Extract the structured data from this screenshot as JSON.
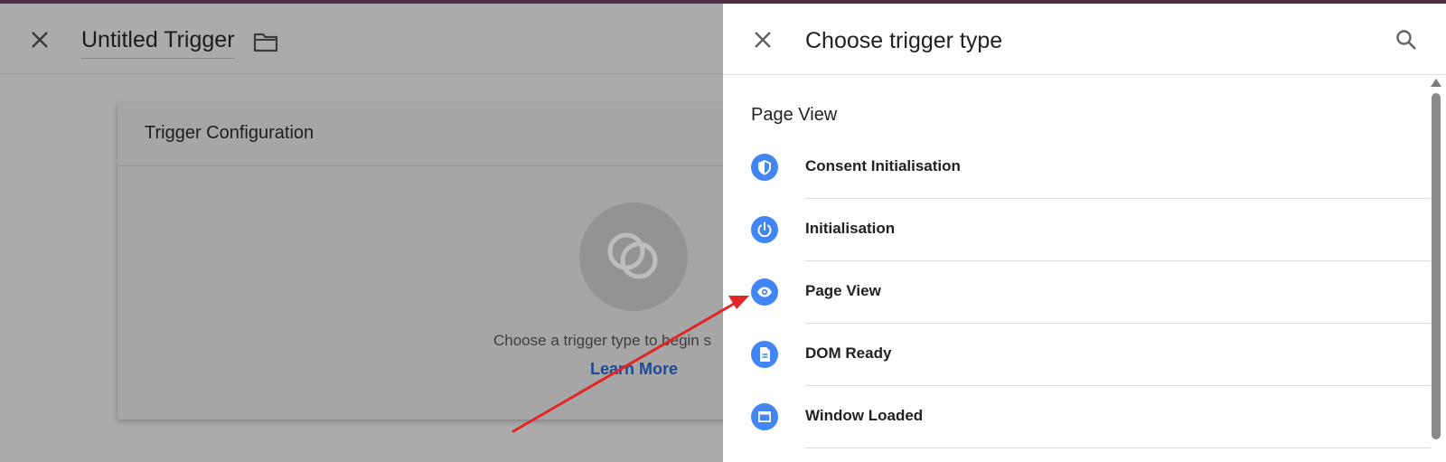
{
  "background": {
    "title": "Untitled Trigger",
    "card": {
      "title": "Trigger Configuration",
      "message": "Choose a trigger type to begin s",
      "link": "Learn More"
    }
  },
  "drawer": {
    "title": "Choose trigger type",
    "section": "Page View",
    "items": [
      {
        "label": "Consent Initialisation",
        "icon": "shield-icon"
      },
      {
        "label": "Initialisation",
        "icon": "power-icon"
      },
      {
        "label": "Page View",
        "icon": "eye-icon"
      },
      {
        "label": "DOM Ready",
        "icon": "document-icon"
      },
      {
        "label": "Window Loaded",
        "icon": "window-icon"
      }
    ]
  },
  "colors": {
    "accent": "#4285f4",
    "arrow": "#e32525",
    "header_strip": "#4e2f45"
  }
}
